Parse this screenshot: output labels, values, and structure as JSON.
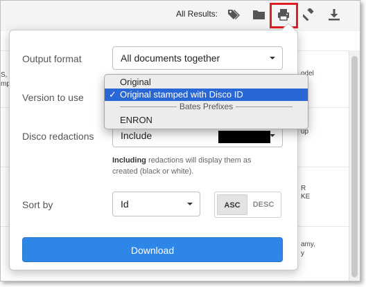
{
  "toolbar": {
    "all_results_label": "All Results:",
    "icons": [
      "tag-icon",
      "folder-icon",
      "print-icon",
      "gavel-icon",
      "download-icon"
    ]
  },
  "background_fragments": [
    {
      "text": "S,"
    },
    {
      "text": "mp"
    },
    {
      "text": "odel"
    },
    {
      "text": "up"
    },
    {
      "text": "R"
    },
    {
      "text": "KE"
    },
    {
      "text": "amy,"
    },
    {
      "text": "y"
    }
  ],
  "popover": {
    "output_format": {
      "label": "Output format",
      "value": "All documents together"
    },
    "version_to_use": {
      "label": "Version to use"
    },
    "disco_redactions": {
      "label": "Disco redactions",
      "value": "Include"
    },
    "hint": {
      "bold": "Including",
      "rest": " redactions will display them as created (black or white)."
    },
    "sort_by": {
      "label": "Sort by",
      "value": "Id",
      "asc": "ASC",
      "desc": "DESC",
      "active": "ASC"
    },
    "download_label": "Download"
  },
  "version_menu": {
    "items": [
      {
        "label": "Original",
        "selected": false
      },
      {
        "label": "Original stamped with Disco ID",
        "selected": true
      }
    ],
    "group_label": "Bates Prefixes",
    "group_items": [
      {
        "label": "ENRON",
        "selected": false
      }
    ],
    "check_glyph": "✓"
  },
  "colors": {
    "accent": "#2e86e6",
    "highlight_border": "#e11d24",
    "menu_selected": "#2a67d6"
  }
}
